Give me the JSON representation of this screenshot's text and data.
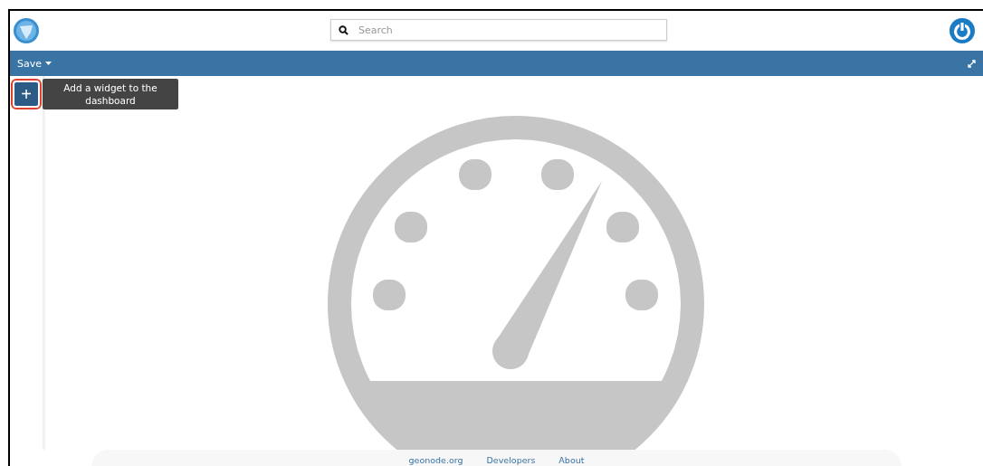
{
  "header": {
    "search": {
      "placeholder": "Search"
    }
  },
  "toolbar": {
    "save_menu": "Save"
  },
  "sidebar": {
    "add_button": "+",
    "tooltip": "Add a widget to the dashboard"
  },
  "footer": {
    "links": [
      "geonode.org",
      "Developers",
      "About"
    ]
  }
}
